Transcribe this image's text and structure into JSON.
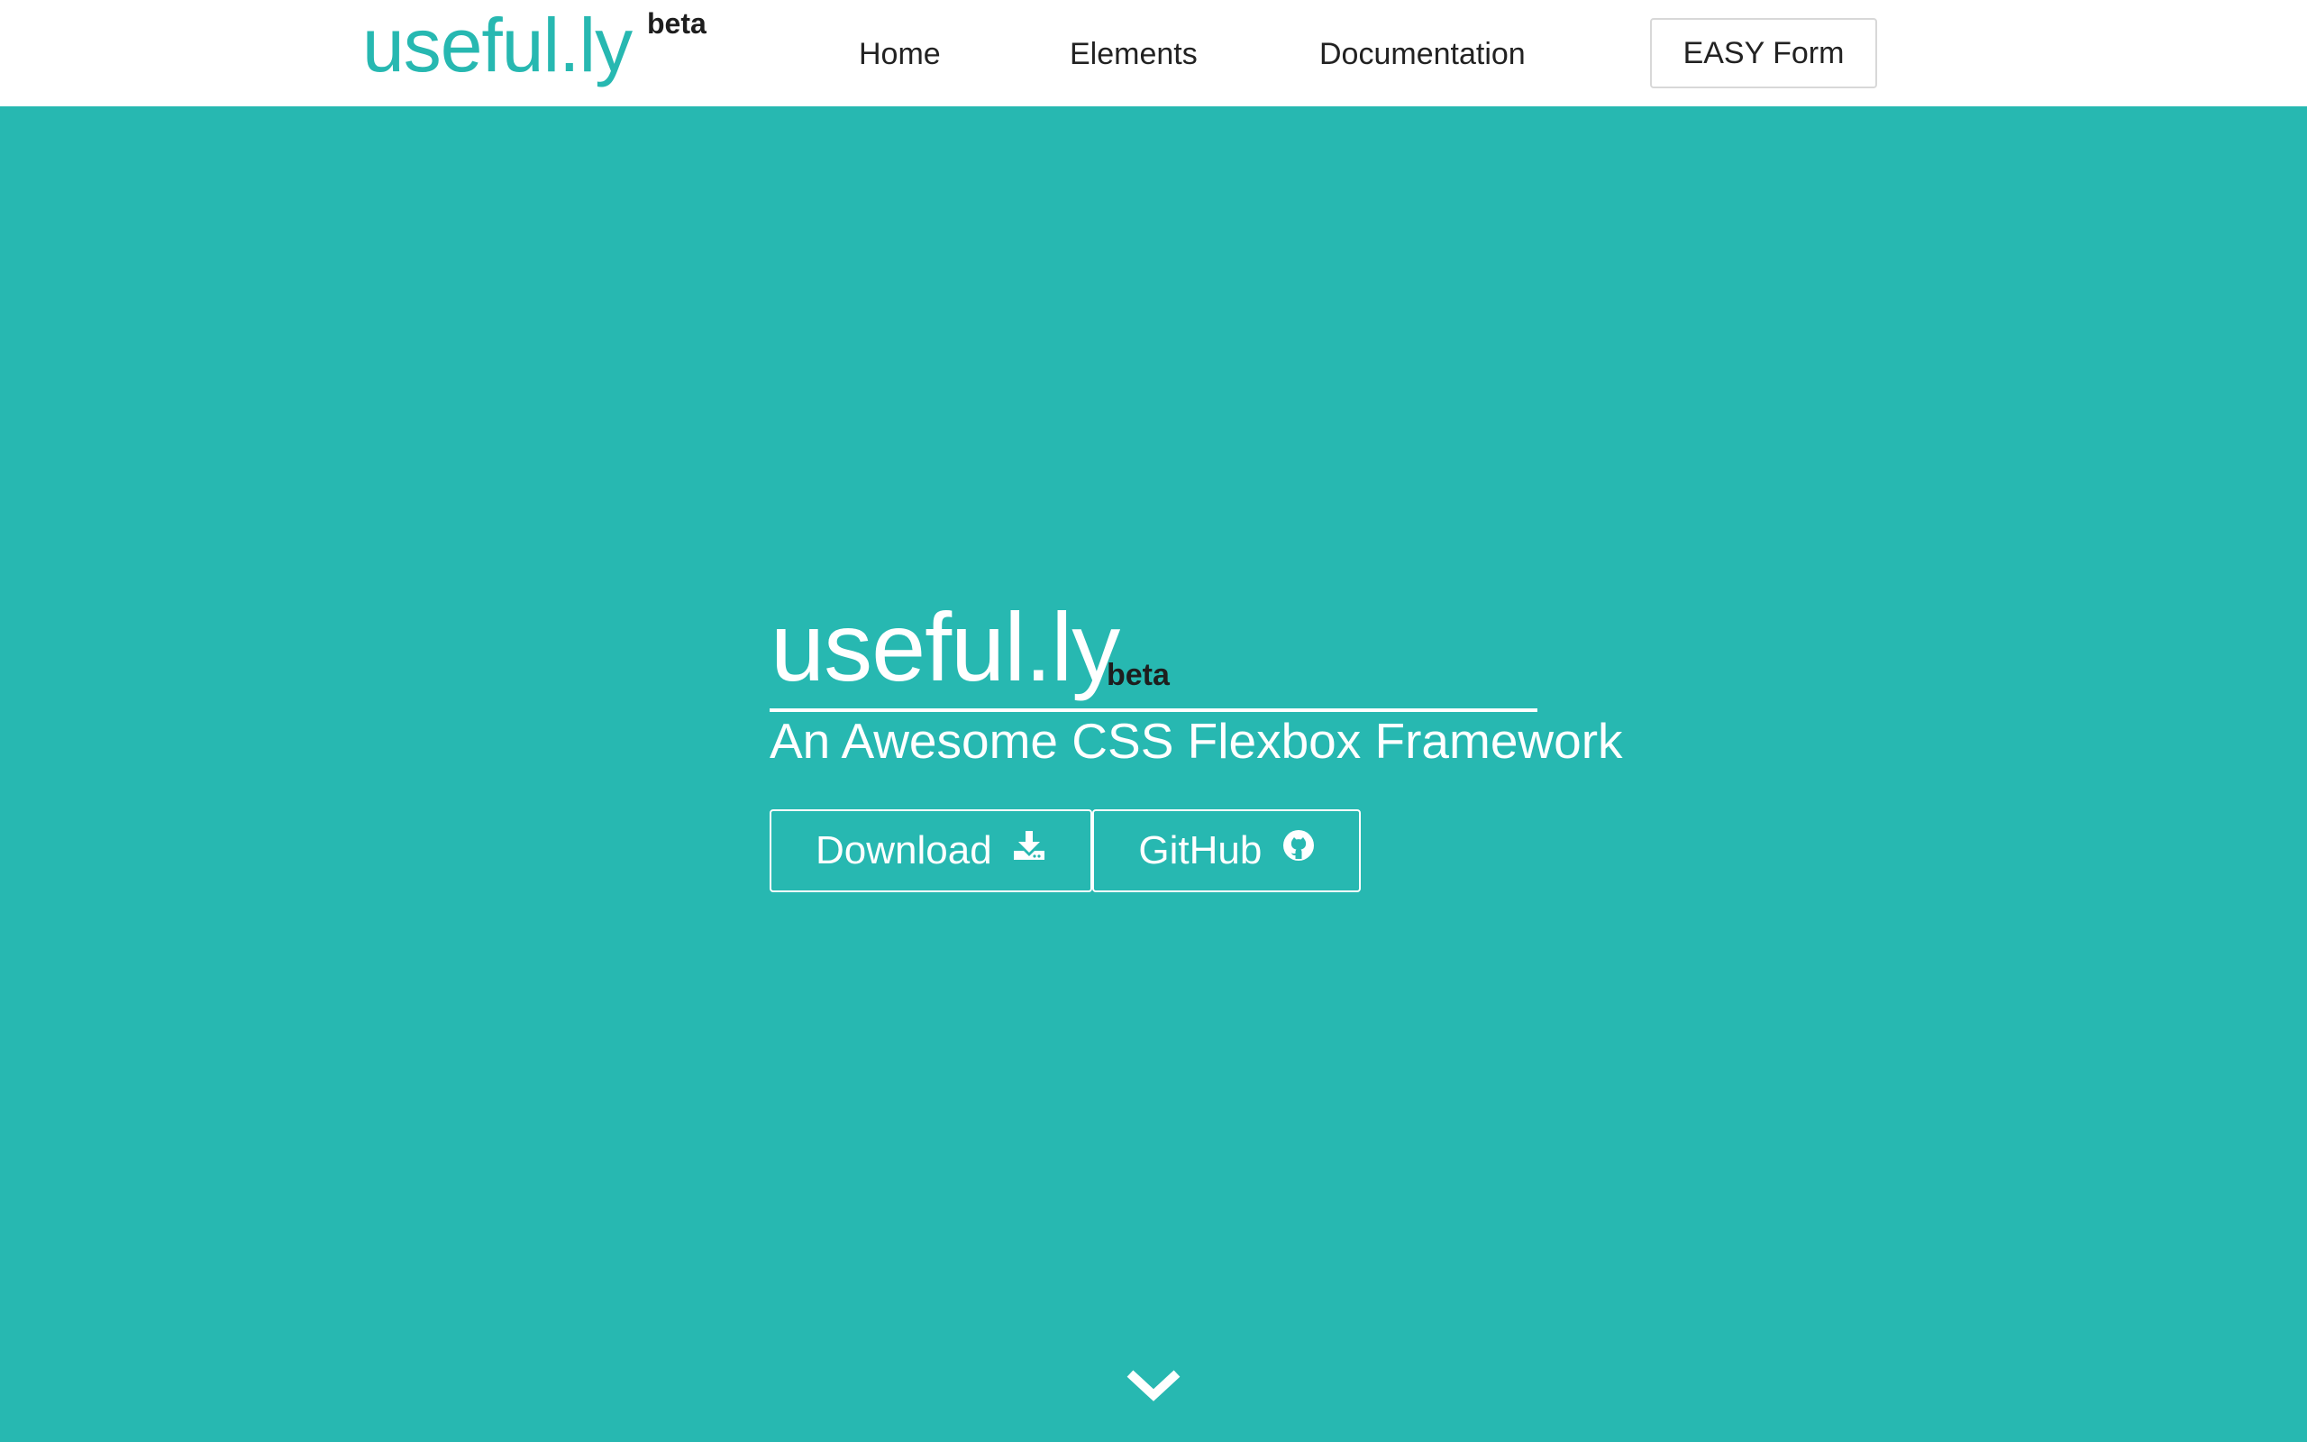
{
  "header": {
    "brand_name": "useful.ly",
    "brand_badge": "beta",
    "nav": {
      "home": "Home",
      "elements": "Elements",
      "documentation": "Documentation"
    },
    "cta_label": "EASY Form"
  },
  "hero": {
    "title": "useful.ly",
    "title_badge": "beta",
    "subtitle": "An Awesome CSS Flexbox Framework",
    "buttons": {
      "download": {
        "label": "Download",
        "icon": "download-icon"
      },
      "github": {
        "label": "GitHub",
        "icon": "github-icon"
      }
    },
    "scroll_icon": "chevron-down-icon"
  },
  "colors": {
    "accent": "#27b8b1",
    "header_bg": "#ffffff",
    "text_dark": "#222222",
    "badge_text": "#1e1e1e"
  }
}
